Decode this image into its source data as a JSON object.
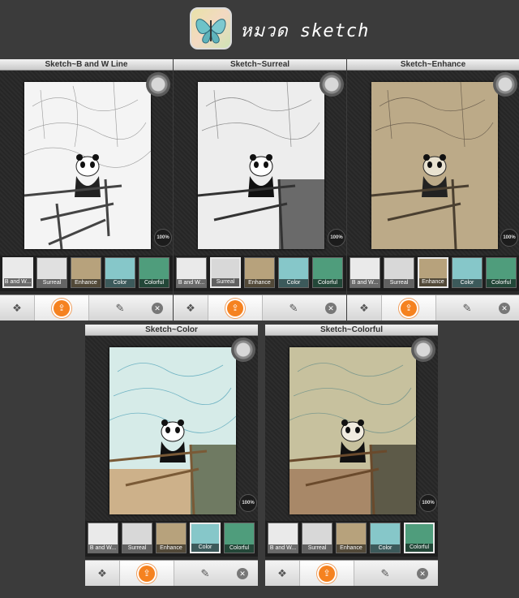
{
  "header": {
    "title": "หมวด sketch"
  },
  "panels": [
    {
      "title": "Sketch~B and W Line",
      "zoom": "100%",
      "variant": "bw"
    },
    {
      "title": "Sketch~Surreal",
      "zoom": "100%",
      "variant": "surreal"
    },
    {
      "title": "Sketch~Enhance",
      "zoom": "100%",
      "variant": "enhance"
    },
    {
      "title": "Sketch~Color",
      "zoom": "100%",
      "variant": "color"
    },
    {
      "title": "Sketch~Colorful",
      "zoom": "100%",
      "variant": "colorful"
    }
  ],
  "filters": [
    "B and W...",
    "Surreal",
    "Enhance",
    "Color",
    "Colorful"
  ],
  "colors": {
    "accent": "#f58220",
    "background": "#3b3b3b"
  },
  "icons": [
    "rotate-icon",
    "share-icon",
    "edit-icon",
    "close-icon",
    "toggle-icon"
  ]
}
